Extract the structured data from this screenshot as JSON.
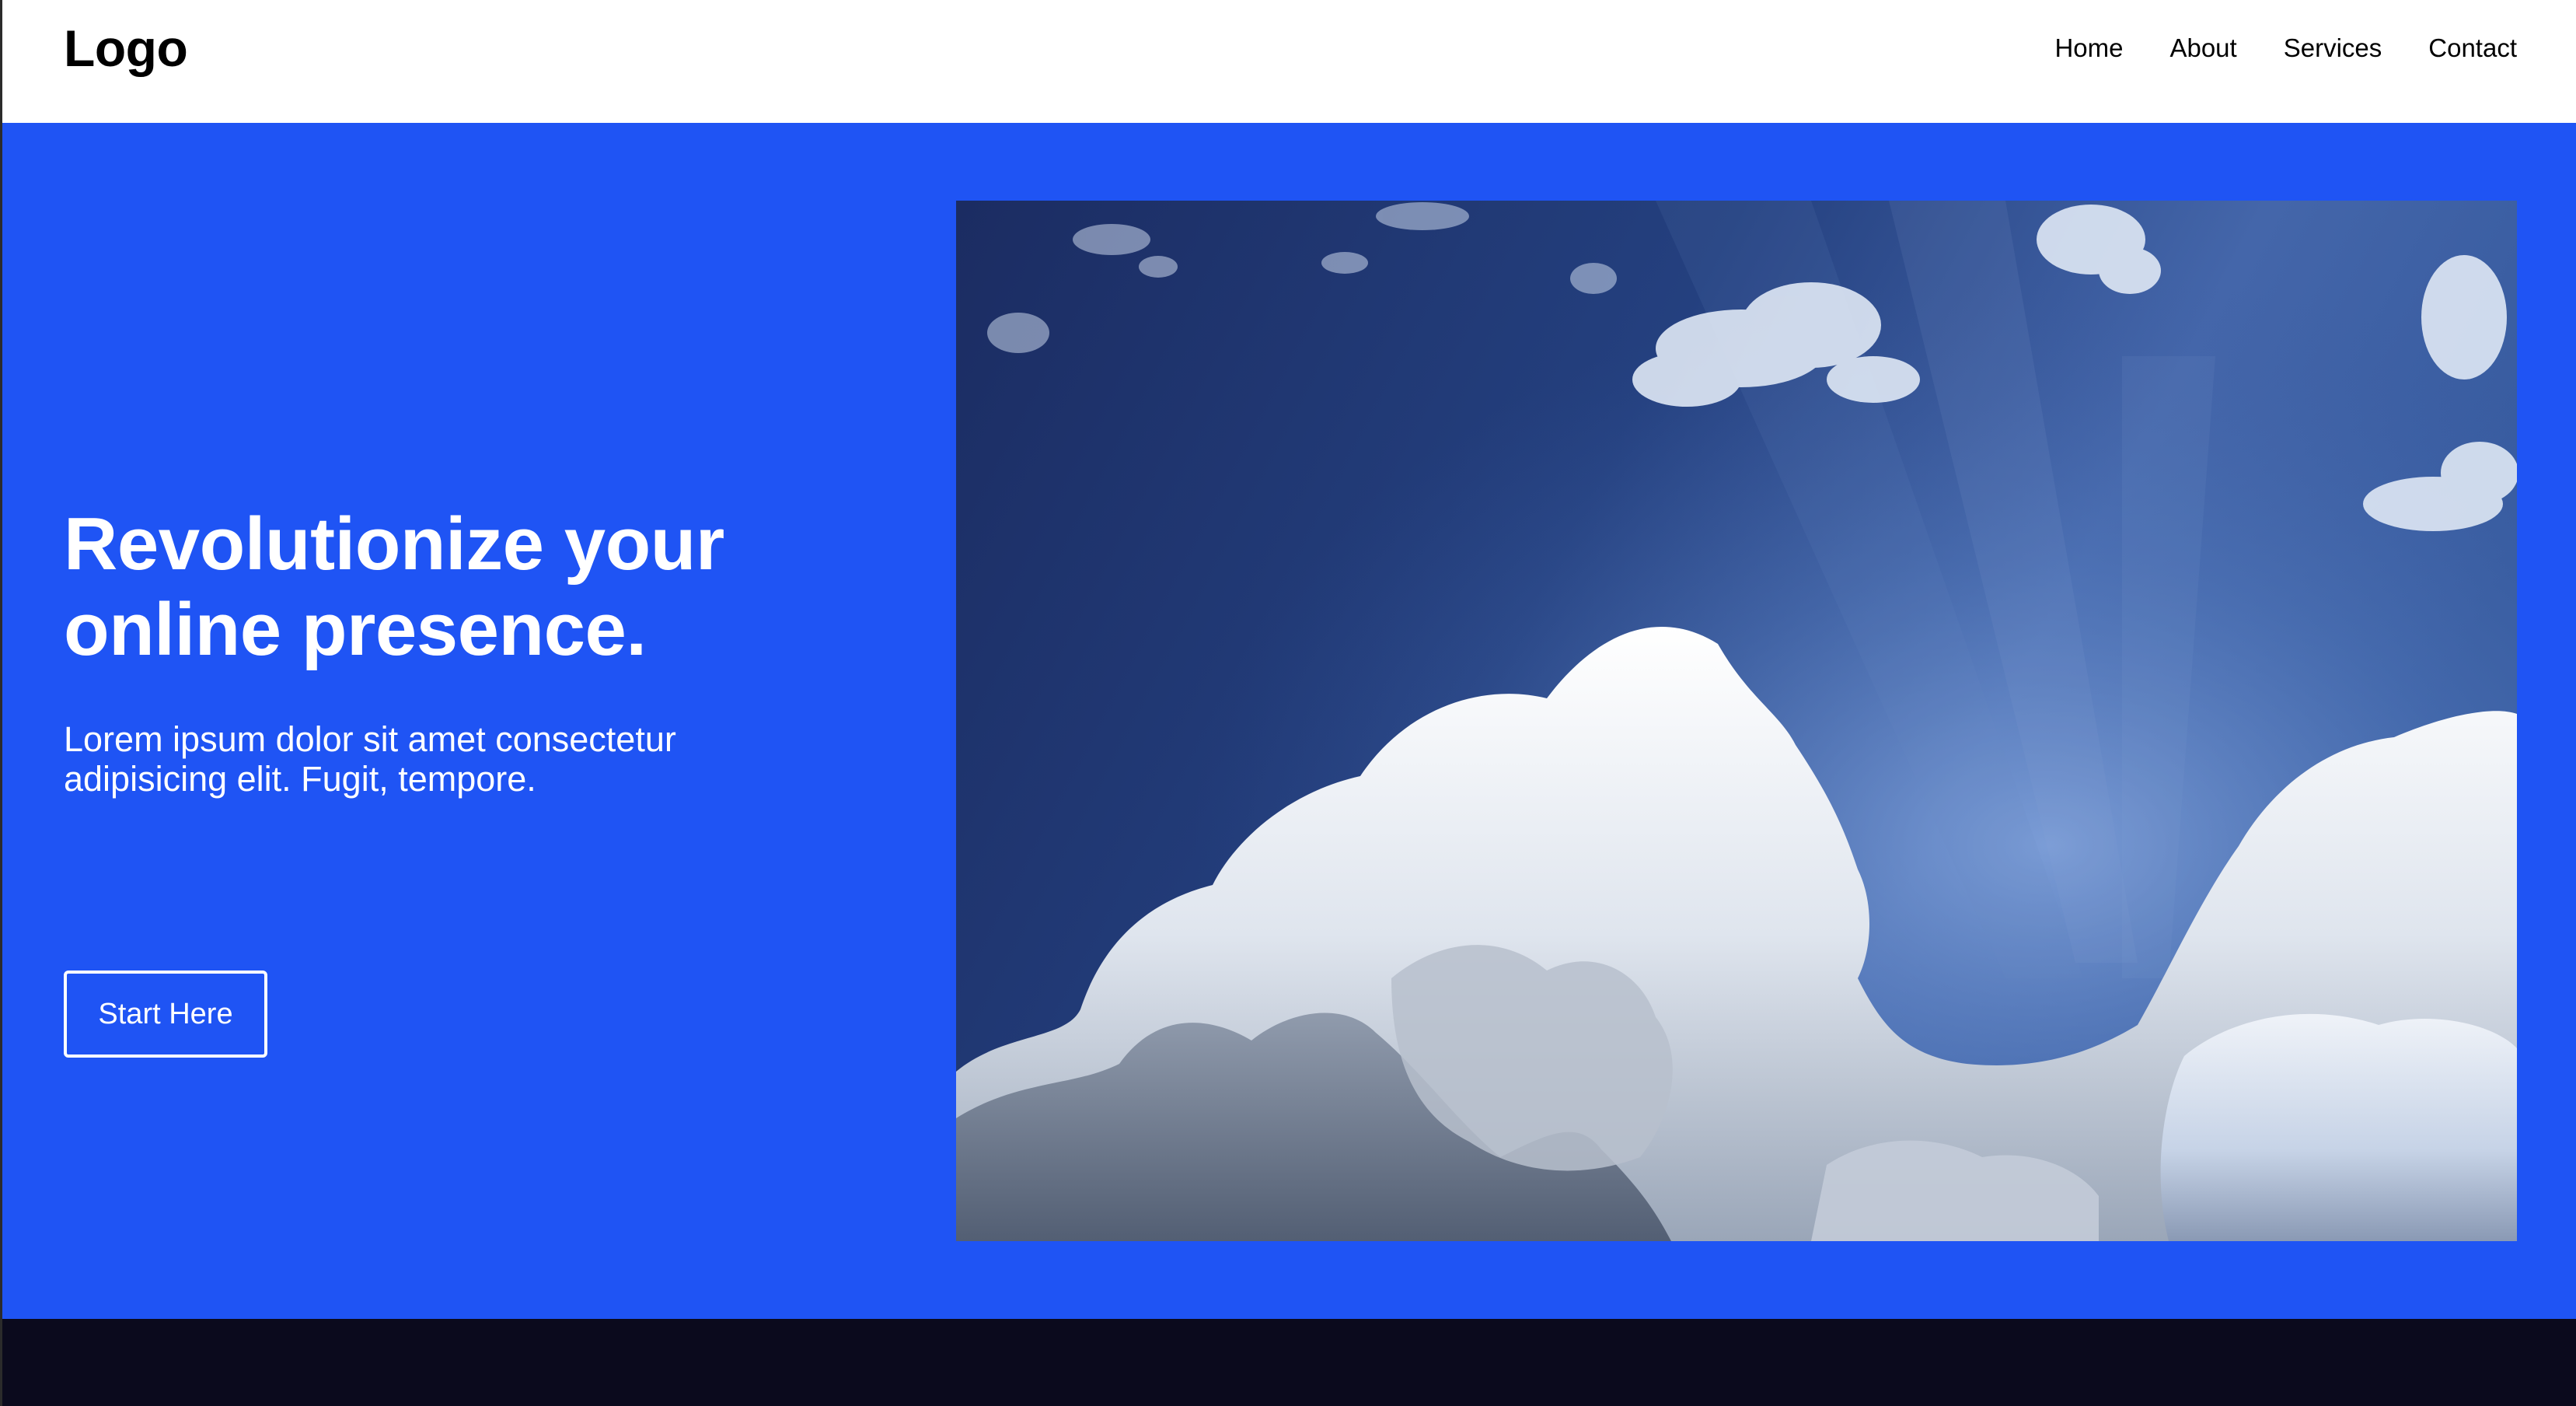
{
  "header": {
    "logo": "Logo",
    "nav": [
      "Home",
      "About",
      "Services",
      "Contact"
    ]
  },
  "hero": {
    "title_line1": "Revolutionize your",
    "title_line2": "online presence.",
    "description": "Lorem ipsum dolor sit amet consectetur adipisicing elit. Fugit, tempore.",
    "cta_label": "Start Here",
    "image_icon": "sky-clouds-photo"
  },
  "colors": {
    "hero_background": "#1f54f4",
    "header_background": "#ffffff",
    "footer_background": "#0b0a1d",
    "text_light": "#ffffff",
    "text_dark": "#000000"
  }
}
